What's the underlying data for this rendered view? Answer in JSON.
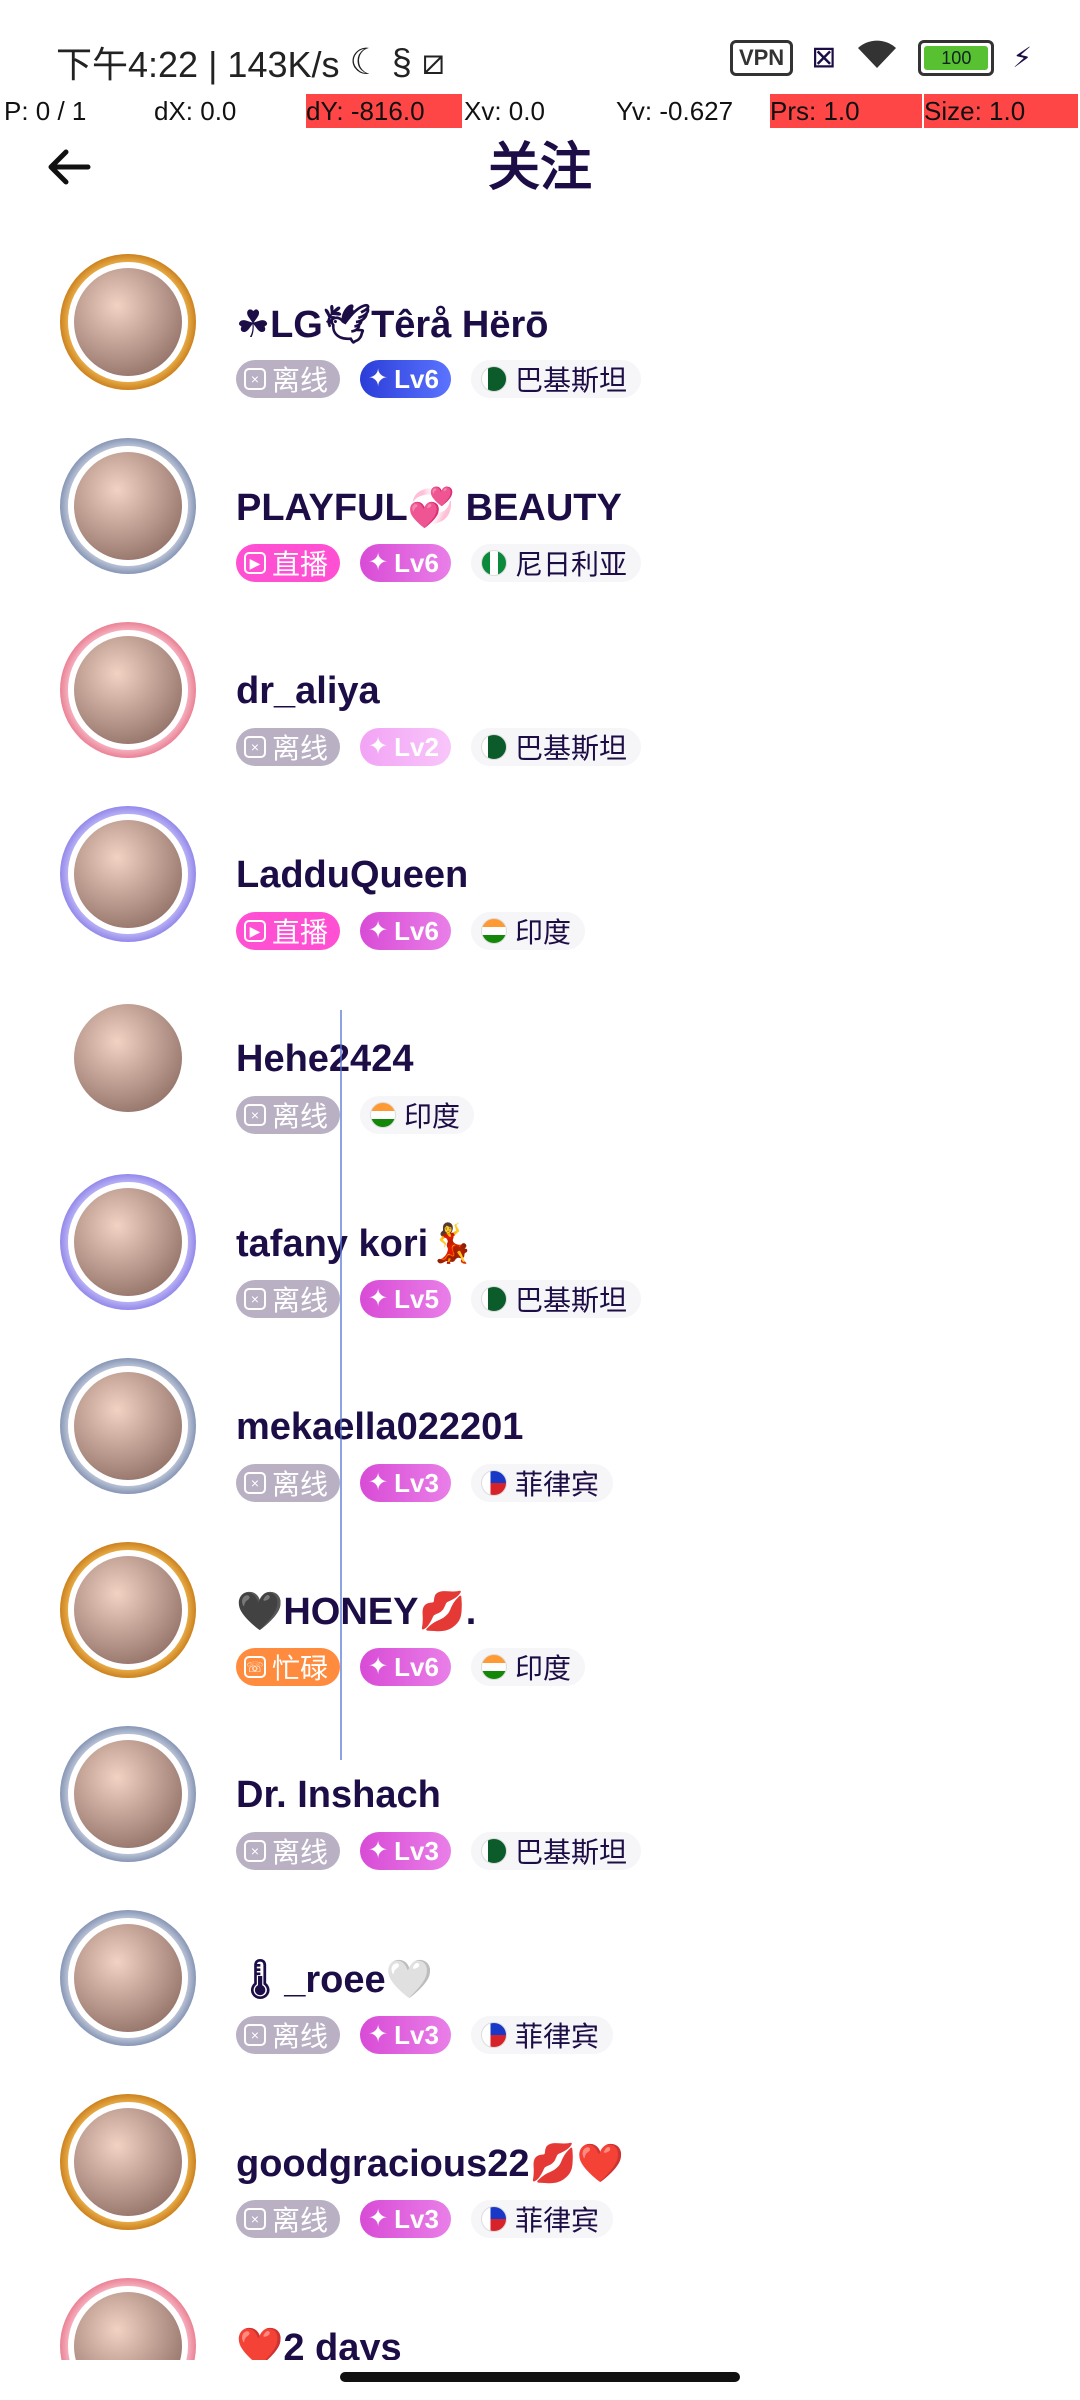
{
  "status_bar": {
    "time_text": "下午4:22 | 143K/s",
    "vpn_label": "VPN",
    "battery_text": "100"
  },
  "debug": {
    "p": "P: 0 / 1",
    "dx": "dX: 0.0",
    "dy": "dY: -816.0",
    "xv": "Xv: 0.0",
    "yv": "Yv: -0.627",
    "prs": "Prs: 1.0",
    "size": "Size: 1.0"
  },
  "header": {
    "title": "关注"
  },
  "users": [
    {
      "name": "☘LG🕊Têrå Hërō",
      "status": "离线",
      "status_type": "offline",
      "level": "Lv6",
      "level_style": "blue",
      "country": "巴基斯坦",
      "flag": "pk",
      "frame": "gold"
    },
    {
      "name": "PLAYFUL💞 BEAUTY",
      "status": "直播",
      "status_type": "live",
      "level": "Lv6",
      "level_style": "mid",
      "country": "尼日利亚",
      "flag": "ng",
      "frame": "silver"
    },
    {
      "name": "dr_aliya",
      "status": "离线",
      "status_type": "offline",
      "level": "Lv2",
      "level_style": "light",
      "country": "巴基斯坦",
      "flag": "pk",
      "frame": "pink"
    },
    {
      "name": "LadduQueen",
      "status": "直播",
      "status_type": "live",
      "level": "Lv6",
      "level_style": "mid",
      "country": "印度",
      "flag": "in",
      "frame": "purple"
    },
    {
      "name": "Hehe2424",
      "status": "离线",
      "status_type": "offline",
      "level": "",
      "level_style": "",
      "country": "印度",
      "flag": "in",
      "frame": "none"
    },
    {
      "name": "tafany kori💃",
      "status": "离线",
      "status_type": "offline",
      "level": "Lv5",
      "level_style": "mid",
      "country": "巴基斯坦",
      "flag": "pk",
      "frame": "purple"
    },
    {
      "name": "mekaella022201",
      "status": "离线",
      "status_type": "offline",
      "level": "Lv3",
      "level_style": "mid",
      "country": "菲律宾",
      "flag": "ph",
      "frame": "silver"
    },
    {
      "name": "🖤HONEY💋.",
      "status": "忙碌",
      "status_type": "busy",
      "level": "Lv6",
      "level_style": "mid",
      "country": "印度",
      "flag": "in",
      "frame": "gold"
    },
    {
      "name": "Dr. Inshach",
      "status": "离线",
      "status_type": "offline",
      "level": "Lv3",
      "level_style": "mid",
      "country": "巴基斯坦",
      "flag": "pk",
      "frame": "silver"
    },
    {
      "name": "🌡_roee🤍",
      "status": "离线",
      "status_type": "offline",
      "level": "Lv3",
      "level_style": "mid",
      "country": "菲律宾",
      "flag": "ph",
      "frame": "silver"
    },
    {
      "name": "goodgracious22💋❤️",
      "status": "离线",
      "status_type": "offline",
      "level": "Lv3",
      "level_style": "mid",
      "country": "菲律宾",
      "flag": "ph",
      "frame": "gold"
    },
    {
      "name": "❤️2 days",
      "status": "",
      "status_type": "",
      "level": "",
      "level_style": "",
      "country": "",
      "flag": "",
      "frame": "pink"
    }
  ]
}
